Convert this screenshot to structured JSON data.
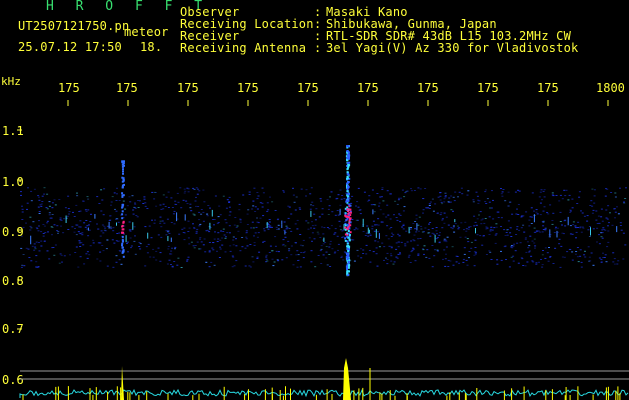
{
  "header": {
    "title": "H R O F F T",
    "filename": "UT2507121750.pn",
    "meteor_label": "meteor",
    "datetime": "25.07.12 17:50",
    "count": "18.",
    "info": [
      {
        "label": "Observer",
        "value": "Masaki Kano"
      },
      {
        "label": "Receiving Location",
        "value": "Shibukawa, Gunma, Japan"
      },
      {
        "label": "Receiver",
        "value": "RTL-SDR SDR# 43dB L15 103.2MHz CW"
      },
      {
        "label": "Receiving Antenna",
        "value": "3el Yagi(V) Az 330 for Vladivostok"
      }
    ],
    "colon": ":"
  },
  "axes": {
    "unit": "kHz",
    "time_ticks": [
      "175",
      "175",
      "175",
      "175",
      "175",
      "175",
      "175",
      "175",
      "175",
      "1800"
    ],
    "freq_ticks": [
      "1.1",
      "1.0",
      "0.9",
      "0.8",
      "0.7",
      "0.6"
    ]
  },
  "colors": {
    "text": "#ffff3a",
    "title": "#38e070",
    "noise": "#1a2fd0",
    "echo": "#ff2080",
    "power": "#ffff00",
    "floor": "#28d8e0"
  }
}
